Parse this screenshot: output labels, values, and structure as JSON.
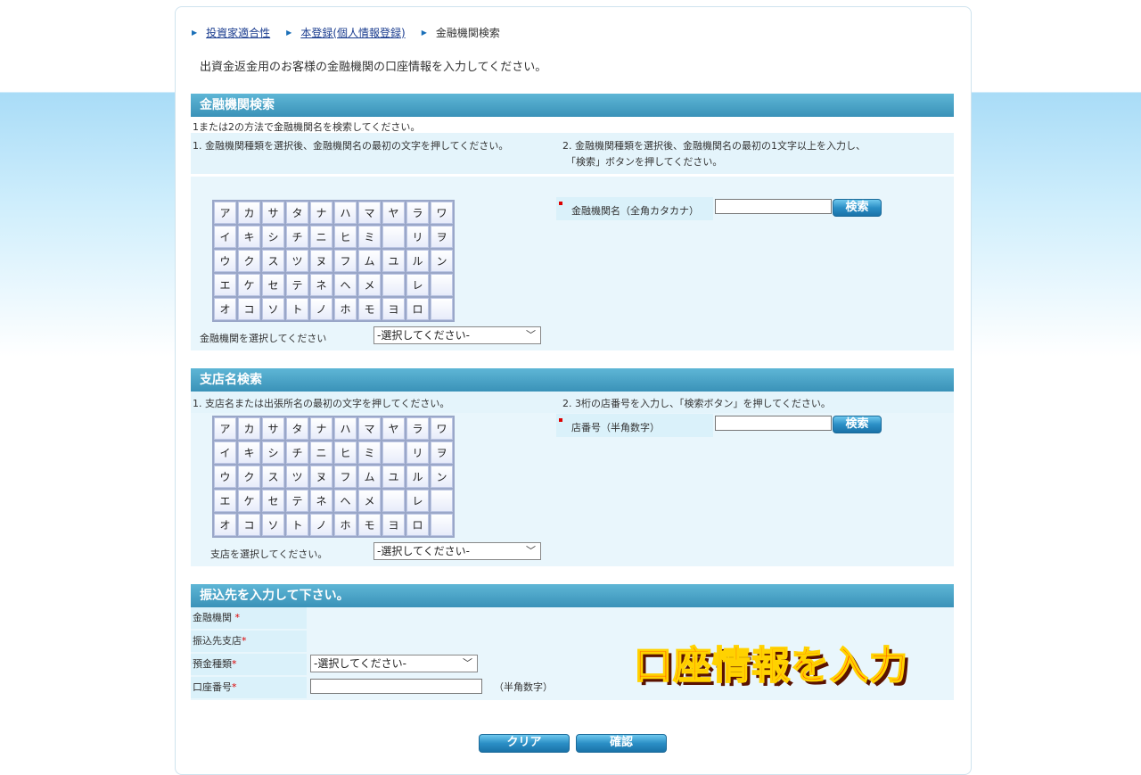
{
  "breadcrumb": {
    "items": [
      {
        "label": "投資家適合性",
        "link": true
      },
      {
        "label": "本登録(個人情報登録)",
        "link": true
      },
      {
        "label": "金融機関検索",
        "link": false
      }
    ]
  },
  "intro": "出資金返金用のお客様の金融機関の口座情報を入力してください。",
  "bank_search": {
    "title": "金融機関検索",
    "note": "1または2の方法で金融機関名を検索してください。",
    "method1": "1. 金融機関種類を選択後、金融機関名の最初の文字を押してください。",
    "method2_line1": "2. 金融機関種類を選択後、金融機関名の最初の1文字以上を入力し、",
    "method2_line2": "「検索」ボタンを押してください。",
    "name_label": "金融機関名（全角カタカナ）",
    "search_button": "検索",
    "select_label": "金融機関を選択してください",
    "select_value": "-選択してください-"
  },
  "branch_search": {
    "title": "支店名検索",
    "method1": "1. 支店名または出張所名の最初の文字を押してください。",
    "method2": "2. 3桁の店番号を入力し、「検索ボタン」を押してください。",
    "code_label": "店番号（半角数字）",
    "search_button": "検索",
    "select_label": "支店を選択してください。",
    "select_value": "-選択してください-"
  },
  "kana_rows": [
    [
      "ア",
      "カ",
      "サ",
      "タ",
      "ナ",
      "ハ",
      "マ",
      "ヤ",
      "ラ",
      "ワ"
    ],
    [
      "イ",
      "キ",
      "シ",
      "チ",
      "ニ",
      "ヒ",
      "ミ",
      "",
      "リ",
      "ヲ"
    ],
    [
      "ウ",
      "ク",
      "ス",
      "ツ",
      "ヌ",
      "フ",
      "ム",
      "ユ",
      "ル",
      "ン"
    ],
    [
      "エ",
      "ケ",
      "セ",
      "テ",
      "ネ",
      "ヘ",
      "メ",
      "",
      "レ",
      ""
    ],
    [
      "オ",
      "コ",
      "ソ",
      "ト",
      "ノ",
      "ホ",
      "モ",
      "ヨ",
      "ロ",
      ""
    ]
  ],
  "transfer": {
    "title": "振込先を入力して下さい。",
    "bank_label": "金融機関",
    "branch_label": "振込先支店",
    "deposit_label": "預金種類",
    "deposit_value": "-選択してください-",
    "account_label": "口座番号",
    "account_hint": "（半角数字）",
    "required_mark": "*",
    "promo": "口座情報を入力"
  },
  "buttons": {
    "clear": "クリア",
    "confirm": "確認"
  },
  "colors": {
    "header": "#3a92b8",
    "panel": "#e9f6fc",
    "promo": "#ff3d00"
  }
}
